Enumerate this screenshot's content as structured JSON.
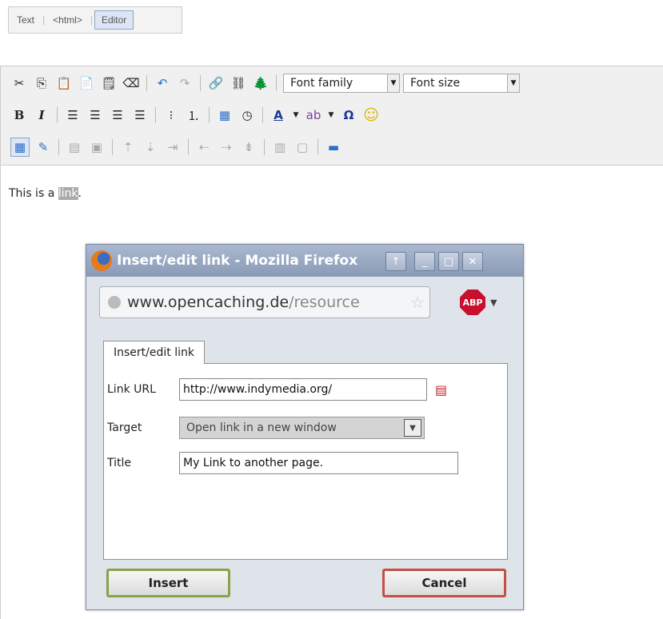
{
  "modes": {
    "text": "Text",
    "html": "<html>",
    "editor": "Editor"
  },
  "toolbar": {
    "font_family": "Font family",
    "font_size": "Font size",
    "bold": "B",
    "italic": "I"
  },
  "content": {
    "before": "This is a ",
    "link": "link",
    "after": "."
  },
  "dialog": {
    "title": "Insert/edit link - Mozilla Firefox",
    "url_host": "www.opencaching.de",
    "url_path": "/resource",
    "abp": "ABP",
    "tab": "Insert/edit link",
    "link_url_label": "Link URL",
    "link_url_value": "http://www.indymedia.org/",
    "target_label": "Target",
    "target_value": "Open link in a new window",
    "title_label": "Title",
    "title_value": "My Link to another page.",
    "insert_label": "Insert",
    "cancel_label": "Cancel"
  },
  "colors": {
    "accent": "#8aa14a",
    "cancel": "#c44f44",
    "titlebar": "#8a9ab6"
  }
}
